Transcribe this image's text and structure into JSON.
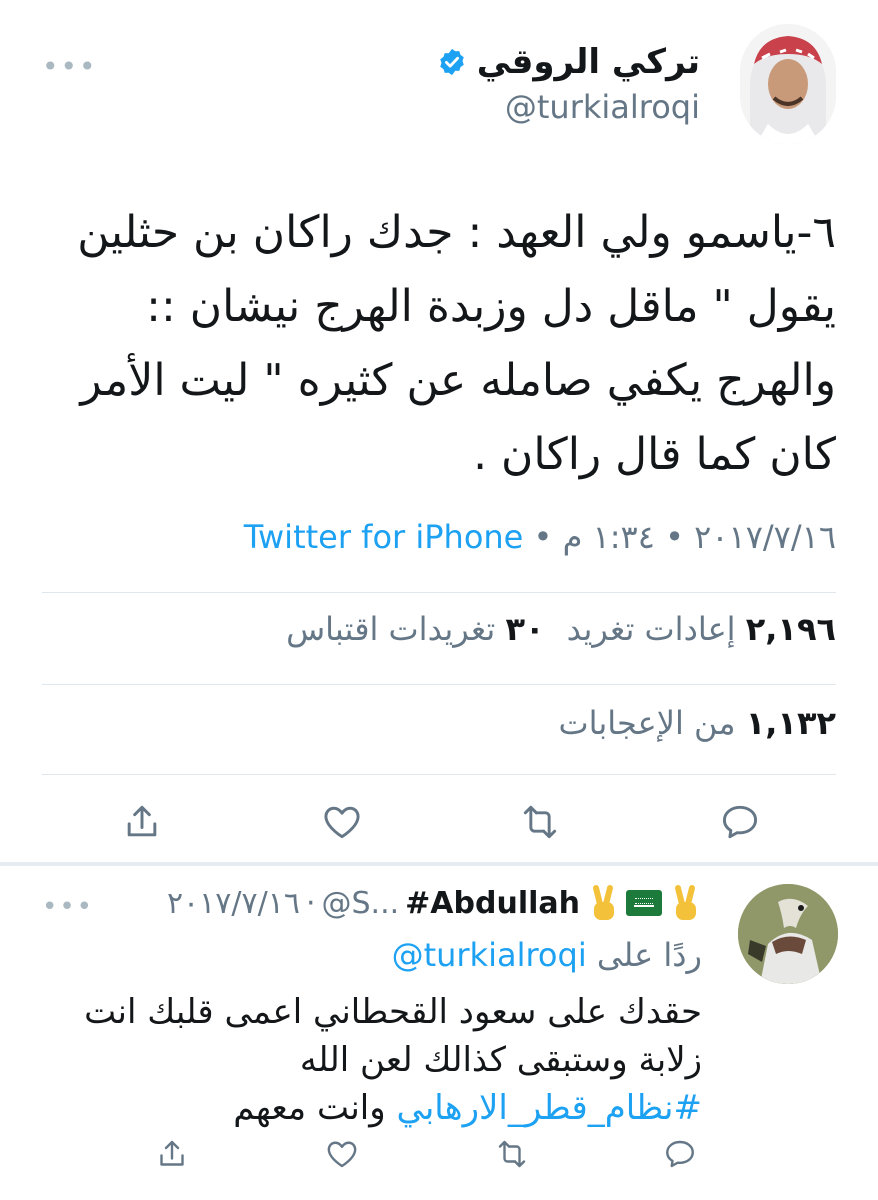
{
  "main_tweet": {
    "display_name": "تركي الروقي",
    "handle": "@turkialroqi",
    "more_label": "•••",
    "text_lines": [
      "٦-ياسمو ولي العهد : جدك راكان بن حثلين",
      "يقول \" ماقل دل وزبدة الهرج نيشان ::",
      "والهرج يكفي صامله عن كثيره \" ليت الأمر",
      "كان كما قال راكان ."
    ],
    "date": "٢٠١٧/٧/١٦",
    "separator": " • ",
    "time": "١:٣٤ م",
    "source": "Twitter for iPhone",
    "retweets_count": "٢,١٩٦",
    "retweets_label": "إعادات تغريد",
    "quotes_count": "٣٠",
    "quotes_label": "تغريدات اقتباس",
    "likes_count": "١,١٣٢",
    "likes_label": "من الإعجابات"
  },
  "reply_tweet": {
    "display_name": "#Abdullah",
    "handle": "@S...",
    "date": "٢٠١٧/٧/١٦",
    "separator": "·",
    "more_label": "•••",
    "reply_prefix": "ردًا على",
    "reply_mention": "@turkialroqi",
    "text_lines": [
      "حقدك على سعود القحطاني اعمى قلبك انت",
      "زلابة وستبقى كذالك لعن الله"
    ],
    "hashtag": "#نظام_قطر_الارهابي",
    "text_tail": " وانت معهم"
  },
  "icons": {
    "verified_color": "#1da1f2",
    "action_color": "#657786",
    "link_color": "#1da1f2"
  }
}
